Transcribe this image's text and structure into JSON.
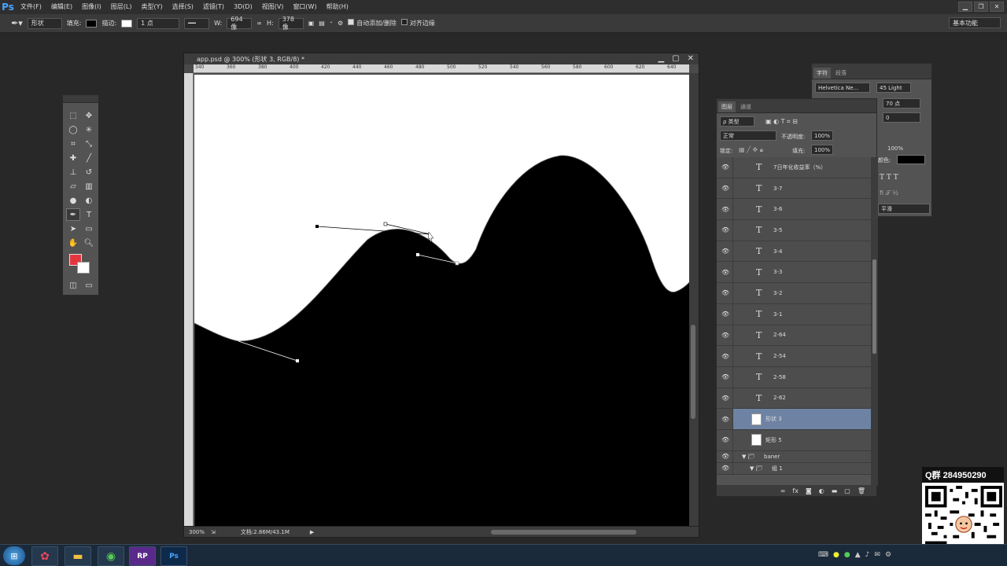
{
  "app": {
    "logo": "Ps",
    "accent": "#4aa3ff"
  },
  "menu": [
    "文件(F)",
    "编辑(E)",
    "图像(I)",
    "图层(L)",
    "类型(Y)",
    "选择(S)",
    "滤镜(T)",
    "3D(D)",
    "视图(V)",
    "窗口(W)",
    "帮助(H)"
  ],
  "options": {
    "mode": "形状",
    "fill_label": "填充:",
    "stroke_label": "描边:",
    "stroke_width": "1 点",
    "w_label": "W:",
    "w_value": "694 像",
    "h_label": "H:",
    "h_value": "378 像",
    "auto_add_delete": "自动添加/删除",
    "align_edges": "对齐边缘",
    "workspace": "基本功能"
  },
  "document": {
    "title": "app.psd @ 300% (形状 3, RGB/8) *",
    "ruler_h": [
      "340",
      "360",
      "380",
      "400",
      "420",
      "440",
      "460",
      "480",
      "500",
      "520",
      "540",
      "560",
      "580",
      "600",
      "620",
      "640"
    ],
    "zoom": "300%",
    "doc_size": "文档:2.86M/43.1M"
  },
  "character_panel": {
    "tabs": [
      "字符",
      "段落"
    ],
    "font_family": "Helvetica Ne...",
    "font_style": "45 Light",
    "leading": "70 点",
    "tracking": "0",
    "scale": "100%",
    "color_label": "颜色:",
    "antialias": "平滑",
    "color": "#000000"
  },
  "layers_panel": {
    "tabs": [
      "图层",
      "通道"
    ],
    "filter_label": "ρ 类型",
    "blend_mode": "正常",
    "opacity_label": "不透明度:",
    "opacity": "100%",
    "lock_label": "锁定:",
    "fill_label": "填充:",
    "fill": "100%",
    "layers": [
      {
        "name": "7日年化收益率（%）",
        "kind": "text"
      },
      {
        "name": "3-7",
        "kind": "text"
      },
      {
        "name": "3-6",
        "kind": "text"
      },
      {
        "name": "3-5",
        "kind": "text"
      },
      {
        "name": "3-4",
        "kind": "text"
      },
      {
        "name": "3-3",
        "kind": "text"
      },
      {
        "name": "3-2",
        "kind": "text"
      },
      {
        "name": "3-1",
        "kind": "text"
      },
      {
        "name": "2-64",
        "kind": "text"
      },
      {
        "name": "2-54",
        "kind": "text"
      },
      {
        "name": "2-58",
        "kind": "text"
      },
      {
        "name": "2-62",
        "kind": "text"
      },
      {
        "name": "形状 3",
        "kind": "shape",
        "selected": true
      },
      {
        "name": "矩形 5",
        "kind": "shape"
      },
      {
        "name": "baner",
        "kind": "group"
      },
      {
        "name": "组 1",
        "kind": "group"
      }
    ],
    "footer_icons": [
      "link-icon",
      "fx-icon",
      "mask-icon",
      "adjustment-icon",
      "folder-icon",
      "new-layer-icon",
      "trash-icon"
    ]
  },
  "qr": {
    "label": "Q群  284950290"
  },
  "taskbar": {
    "rp_label": "RP",
    "ps_label": "Ps"
  }
}
